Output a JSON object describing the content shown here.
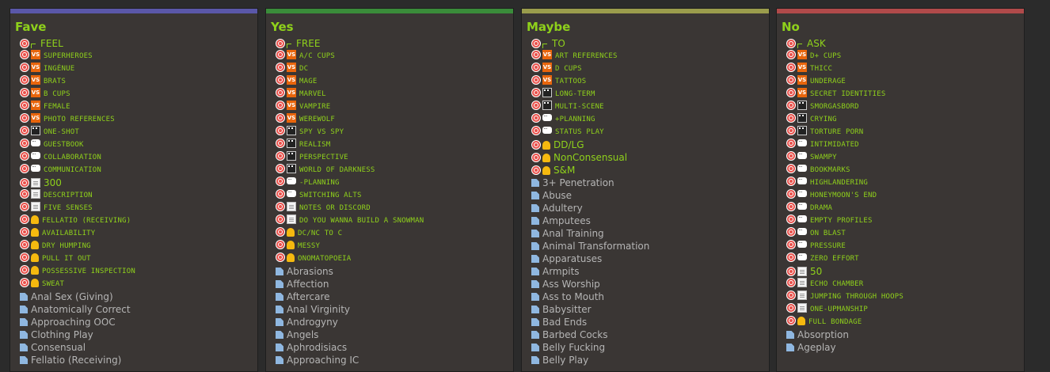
{
  "colors": {
    "fave": "#5a57a8",
    "yes": "#3a8c3a",
    "maybe": "#9a9c4c",
    "no": "#b04a4a",
    "green_text": "#8fd11b",
    "grey_text": "#b5b5b5"
  },
  "columns": [
    {
      "key": "fave",
      "title": "Fave",
      "items": [
        {
          "icon": "bracket",
          "text": "FEEL",
          "style": "big"
        },
        {
          "icon": "vs",
          "text": "SUPERHEROES",
          "style": "sc"
        },
        {
          "icon": "vs",
          "text": "INGÉNUE",
          "style": "sc"
        },
        {
          "icon": "vs",
          "text": "BRATS",
          "style": "sc"
        },
        {
          "icon": "vs",
          "text": "B CUPS",
          "style": "sc"
        },
        {
          "icon": "vs",
          "text": "FEMALE",
          "style": "sc"
        },
        {
          "icon": "vs",
          "text": "PHOTO REFERENCES",
          "style": "sc"
        },
        {
          "icon": "clap",
          "text": "ONE-SHOT",
          "style": "sc"
        },
        {
          "icon": "chat",
          "text": "GUESTBOOK",
          "style": "sc"
        },
        {
          "icon": "chat",
          "text": "COLLABORATION",
          "style": "sc"
        },
        {
          "icon": "chat",
          "text": "COMMUNICATION",
          "style": "sc"
        },
        {
          "icon": "memo",
          "text": "300",
          "style": "big"
        },
        {
          "icon": "memo",
          "text": "DESCRIPTION",
          "style": "sc"
        },
        {
          "icon": "memo",
          "text": "FIVE SENSES",
          "style": "sc"
        },
        {
          "icon": "bell",
          "text": "FELLATIO (RECEIVING)",
          "style": "sc"
        },
        {
          "icon": "bell",
          "text": "AVAILABILITY",
          "style": "sc"
        },
        {
          "icon": "bell",
          "text": "DRY HUMPING",
          "style": "sc"
        },
        {
          "icon": "bell",
          "text": "PULL IT OUT",
          "style": "sc"
        },
        {
          "icon": "bell",
          "text": "POSSESSIVE INSPECTION",
          "style": "sc"
        },
        {
          "icon": "bell",
          "text": "SWEAT",
          "style": "sc"
        },
        {
          "icon": "doc",
          "text": "Anal Sex (Giving)",
          "style": "grey"
        },
        {
          "icon": "doc",
          "text": "Anatomically Correct",
          "style": "grey"
        },
        {
          "icon": "doc",
          "text": "Approaching OOC",
          "style": "grey"
        },
        {
          "icon": "doc",
          "text": "Clothing Play",
          "style": "grey"
        },
        {
          "icon": "doc",
          "text": "Consensual",
          "style": "grey"
        },
        {
          "icon": "doc",
          "text": "Fellatio (Receiving)",
          "style": "grey"
        }
      ]
    },
    {
      "key": "yes",
      "title": "Yes",
      "items": [
        {
          "icon": "bracket",
          "text": "FREE",
          "style": "big"
        },
        {
          "icon": "vs",
          "text": "A/C CUPS",
          "style": "sc"
        },
        {
          "icon": "vs",
          "text": "DC",
          "style": "sc"
        },
        {
          "icon": "vs",
          "text": "MAGE",
          "style": "sc"
        },
        {
          "icon": "vs",
          "text": "MARVEL",
          "style": "sc"
        },
        {
          "icon": "vs",
          "text": "VAMPIRE",
          "style": "sc"
        },
        {
          "icon": "vs",
          "text": "WEREWOLF",
          "style": "sc"
        },
        {
          "icon": "clap",
          "text": "SPY VS SPY",
          "style": "sc"
        },
        {
          "icon": "clap",
          "text": "REALISM",
          "style": "sc"
        },
        {
          "icon": "clap",
          "text": "PERSPECTIVE",
          "style": "sc"
        },
        {
          "icon": "clap",
          "text": "WORLD OF DARKNESS",
          "style": "sc"
        },
        {
          "icon": "chat",
          "text": "-PLANNING",
          "style": "sc"
        },
        {
          "icon": "chat",
          "text": "SWITCHING ALTS",
          "style": "sc"
        },
        {
          "icon": "memo",
          "text": "NOTES OR DISCORD",
          "style": "sc"
        },
        {
          "icon": "memo",
          "text": "DO YOU WANNA BUILD A SNOWMAN",
          "style": "sc"
        },
        {
          "icon": "bell",
          "text": "DC/NC TO C",
          "style": "sc"
        },
        {
          "icon": "bell",
          "text": "MESSY",
          "style": "sc"
        },
        {
          "icon": "bell",
          "text": "ONOMATOPOEIA",
          "style": "sc"
        },
        {
          "icon": "doc",
          "text": "Abrasions",
          "style": "grey"
        },
        {
          "icon": "doc",
          "text": "Affection",
          "style": "grey"
        },
        {
          "icon": "doc",
          "text": "Aftercare",
          "style": "grey"
        },
        {
          "icon": "doc",
          "text": "Anal Virginity",
          "style": "grey"
        },
        {
          "icon": "doc",
          "text": "Androgyny",
          "style": "grey"
        },
        {
          "icon": "doc",
          "text": "Angels",
          "style": "grey"
        },
        {
          "icon": "doc",
          "text": "Aphrodisiacs",
          "style": "grey"
        },
        {
          "icon": "doc",
          "text": "Approaching IC",
          "style": "grey"
        }
      ]
    },
    {
      "key": "maybe",
      "title": "Maybe",
      "items": [
        {
          "icon": "bracket",
          "text": "TO",
          "style": "big"
        },
        {
          "icon": "vs",
          "text": "ART REFERENCES",
          "style": "sc"
        },
        {
          "icon": "vs",
          "text": "D CUPS",
          "style": "sc"
        },
        {
          "icon": "vs",
          "text": "TATTOOS",
          "style": "sc"
        },
        {
          "icon": "clap",
          "text": "LONG-TERM",
          "style": "sc"
        },
        {
          "icon": "clap",
          "text": "MULTI-SCENE",
          "style": "sc"
        },
        {
          "icon": "chat",
          "text": "+PLANNING",
          "style": "sc"
        },
        {
          "icon": "chat",
          "text": "STATUS PLAY",
          "style": "sc"
        },
        {
          "icon": "bell",
          "text": "DD/LG",
          "style": "big"
        },
        {
          "icon": "bell",
          "text": "NonConsensual",
          "style": "big"
        },
        {
          "icon": "bell",
          "text": "S&M",
          "style": "big"
        },
        {
          "icon": "doc",
          "text": "3+ Penetration",
          "style": "grey"
        },
        {
          "icon": "doc",
          "text": "Abuse",
          "style": "grey"
        },
        {
          "icon": "doc",
          "text": "Adultery",
          "style": "grey"
        },
        {
          "icon": "doc",
          "text": "Amputees",
          "style": "grey"
        },
        {
          "icon": "doc",
          "text": "Anal Training",
          "style": "grey"
        },
        {
          "icon": "doc",
          "text": "Animal Transformation",
          "style": "grey"
        },
        {
          "icon": "doc",
          "text": "Apparatuses",
          "style": "grey"
        },
        {
          "icon": "doc",
          "text": "Armpits",
          "style": "grey"
        },
        {
          "icon": "doc",
          "text": "Ass Worship",
          "style": "grey"
        },
        {
          "icon": "doc",
          "text": "Ass to Mouth",
          "style": "grey"
        },
        {
          "icon": "doc",
          "text": "Babysitter",
          "style": "grey"
        },
        {
          "icon": "doc",
          "text": "Bad Ends",
          "style": "grey"
        },
        {
          "icon": "doc",
          "text": "Barbed Cocks",
          "style": "grey"
        },
        {
          "icon": "doc",
          "text": "Belly Fucking",
          "style": "grey"
        },
        {
          "icon": "doc",
          "text": "Belly Play",
          "style": "grey"
        }
      ]
    },
    {
      "key": "no",
      "title": "No",
      "items": [
        {
          "icon": "bracket",
          "text": "ASK",
          "style": "big"
        },
        {
          "icon": "vs",
          "text": "D+ CUPS",
          "style": "sc"
        },
        {
          "icon": "vs",
          "text": "THICC",
          "style": "sc"
        },
        {
          "icon": "vs",
          "text": "UNDERAGE",
          "style": "sc"
        },
        {
          "icon": "vs",
          "text": "SECRET IDENTITIES",
          "style": "sc"
        },
        {
          "icon": "clap",
          "text": "SMORGASBORD",
          "style": "sc"
        },
        {
          "icon": "clap",
          "text": "CRYING",
          "style": "sc"
        },
        {
          "icon": "clap",
          "text": "TORTURE PORN",
          "style": "sc"
        },
        {
          "icon": "chat",
          "text": "INTIMIDATED",
          "style": "sc"
        },
        {
          "icon": "chat",
          "text": "SWAMPY",
          "style": "sc"
        },
        {
          "icon": "chat",
          "text": "BOOKMARKS",
          "style": "sc"
        },
        {
          "icon": "chat",
          "text": "HIGHLANDERING",
          "style": "sc"
        },
        {
          "icon": "chat",
          "text": "HONEYMOON'S END",
          "style": "sc"
        },
        {
          "icon": "chat",
          "text": "DRAMA",
          "style": "sc"
        },
        {
          "icon": "chat",
          "text": "EMPTY PROFILES",
          "style": "sc"
        },
        {
          "icon": "chat",
          "text": "ON BLAST",
          "style": "sc"
        },
        {
          "icon": "chat",
          "text": "PRESSURE",
          "style": "sc"
        },
        {
          "icon": "chat",
          "text": "ZERO EFFORT",
          "style": "sc"
        },
        {
          "icon": "memo",
          "text": "50",
          "style": "big"
        },
        {
          "icon": "memo",
          "text": "ECHO CHAMBER",
          "style": "sc"
        },
        {
          "icon": "memo",
          "text": "JUMPING THROUGH HOOPS",
          "style": "sc"
        },
        {
          "icon": "memo",
          "text": "ONE-UPMANSHIP",
          "style": "sc"
        },
        {
          "icon": "bell",
          "text": "FULL BONDAGE",
          "style": "sc"
        },
        {
          "icon": "doc",
          "text": "Absorption",
          "style": "grey"
        },
        {
          "icon": "doc",
          "text": "Ageplay",
          "style": "grey"
        }
      ]
    }
  ]
}
